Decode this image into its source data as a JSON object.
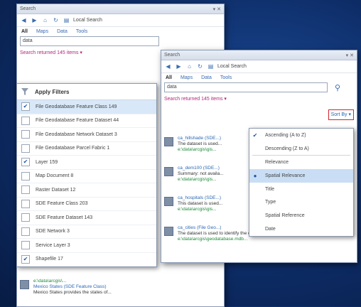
{
  "back_panel": {
    "title": "Search",
    "toolbar_location": "Local Search",
    "tabs": [
      "All",
      "Maps",
      "Data",
      "Tools"
    ],
    "search_value": "data",
    "results_line": "Search returned 145 items ▾",
    "filter_menu": {
      "apply_label": "Apply Filters",
      "items": [
        {
          "label": "File Geodatabase Feature Class 149",
          "checked": true,
          "highlight": true
        },
        {
          "label": "File Geodatabase Feature Dataset 44",
          "checked": false
        },
        {
          "label": "File Geodatabase Network Dataset 3",
          "checked": false
        },
        {
          "label": "File Geodatabase Parcel Fabric 1",
          "checked": false
        },
        {
          "label": "Layer 159",
          "checked": true
        },
        {
          "label": "Map Document 8",
          "checked": false
        },
        {
          "label": "Raster Dataset 12",
          "checked": false
        },
        {
          "label": "SDE Feature Class 203",
          "checked": false
        },
        {
          "label": "SDE Feature Dataset 143",
          "checked": false
        },
        {
          "label": "SDE Network 3",
          "checked": false
        },
        {
          "label": "Service Layer 3",
          "checked": false
        },
        {
          "label": "Shapefile 17",
          "checked": true
        }
      ]
    },
    "footer_row": {
      "path": "e:\\data\\arcgis\\...",
      "title": "Mexico States (SDE Feature Class)",
      "desc": "Mexico States provides the states of..."
    }
  },
  "front_panel": {
    "title": "Search",
    "toolbar_location": "Local Search",
    "tabs": [
      "All",
      "Maps",
      "Data",
      "Tools"
    ],
    "search_value": "data",
    "results_line": "Search returned 145 items ▾",
    "sort_label": "Sort By ▾",
    "results": [
      {
        "title": "ca_hillshade (SDE...)",
        "desc": "The dataset is used...",
        "path": "e:\\data\\arcgis\\gis..."
      },
      {
        "title": "ca_dem100 (SDE...)",
        "desc": "Summary: not availa...",
        "path": "e:\\data\\arcgis\\gis..."
      },
      {
        "title": "ca_hospitals (SDE...)",
        "desc": "This dataset is used...",
        "path": "e:\\data\\arcgis\\gis..."
      },
      {
        "title": "ca_cities (File Geo...)",
        "desc": "The dataset is used to identify the c...",
        "path": "e:\\data\\arcgis\\geodatabase.mdb..."
      }
    ],
    "sort_menu": {
      "items": [
        {
          "label": "Ascending (A to Z)",
          "mark": "✔",
          "highlight": false
        },
        {
          "label": "Descending (Z to A)",
          "mark": "",
          "highlight": false
        },
        {
          "label": "Relevance",
          "mark": "",
          "highlight": false,
          "sep_before": true
        },
        {
          "label": "Spatial Relevance",
          "mark": "●",
          "highlight": true
        },
        {
          "label": "Title",
          "mark": "",
          "highlight": false
        },
        {
          "label": "Type",
          "mark": "",
          "highlight": false
        },
        {
          "label": "Spatial Reference",
          "mark": "",
          "highlight": false
        },
        {
          "label": "Date",
          "mark": "",
          "highlight": false
        }
      ]
    }
  }
}
